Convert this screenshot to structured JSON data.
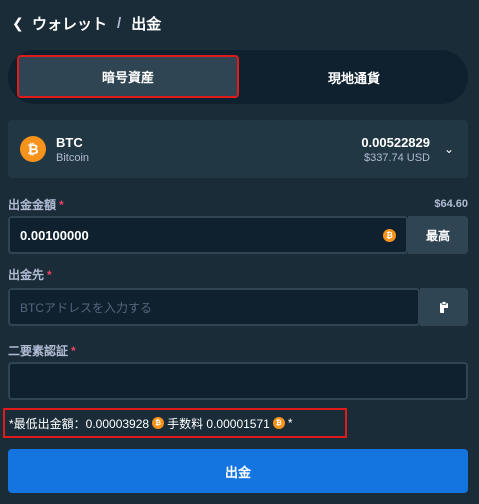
{
  "breadcrumb": {
    "back_icon": "chevron-left-icon",
    "parent": "ウォレット",
    "separator": "/",
    "current": "出金"
  },
  "tabs": [
    {
      "label": "暗号資産",
      "active": true
    },
    {
      "label": "現地通貨",
      "active": false
    }
  ],
  "asset": {
    "icon_glyph": "₿",
    "symbol": "BTC",
    "name": "Bitcoin",
    "balance": "0.00522829",
    "balance_usd": "$337.74 USD",
    "dropdown_icon": "chevron-down-icon"
  },
  "amount": {
    "label": "出金金額",
    "required_mark": "*",
    "usd_value": "$64.60",
    "value": "0.00100000",
    "coin_glyph": "₿",
    "max_label": "最高"
  },
  "destination": {
    "label": "出金先",
    "required_mark": "*",
    "placeholder": "BTCアドレスを入力する",
    "paste_icon": "clipboard-icon"
  },
  "twofa": {
    "label": "二要素認証",
    "required_mark": "*",
    "value": ""
  },
  "min_info": {
    "prefix": "*最低出金額：0.00003928",
    "fee": "手数料 0.00001571",
    "suffix": "*",
    "coin_glyph": "₿"
  },
  "submit_label": "出金",
  "colors": {
    "background": "#1a2c38",
    "input_bg": "#0f212e",
    "panel": "#213743",
    "accent_blue": "#1475e1",
    "btc_orange": "#f7931a",
    "highlight_red": "#e01b1b"
  }
}
